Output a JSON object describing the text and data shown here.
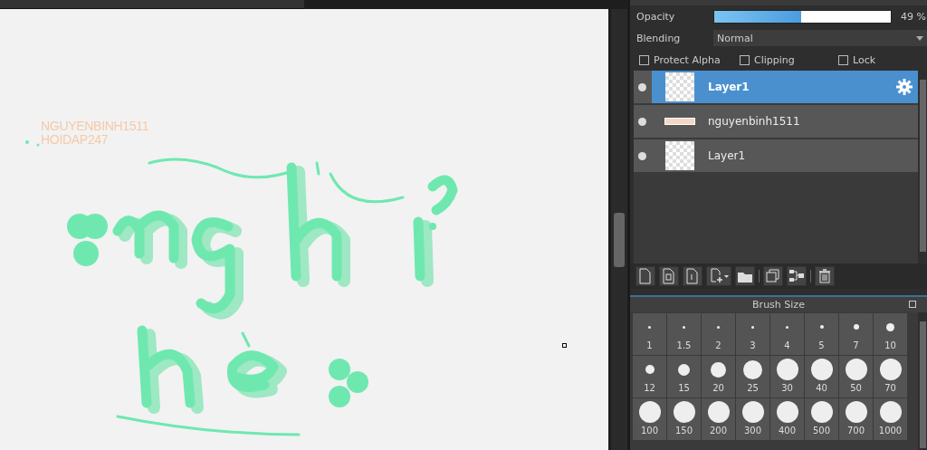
{
  "canvas": {
    "signature": [
      "NGUYENBINH1511",
      "HOIDAP247"
    ]
  },
  "layer_panel": {
    "opacity": {
      "label": "Opacity",
      "level": 0.49,
      "reading": "49 %"
    },
    "blending": {
      "label": "Blending",
      "value": "Normal"
    },
    "options": [
      {
        "label": "Protect Alpha",
        "checked": false
      },
      {
        "label": "Clipping",
        "checked": false
      },
      {
        "label": "Lock",
        "checked": false
      }
    ],
    "layers": [
      {
        "name": "Layer1",
        "selected": true,
        "kind": "blank"
      },
      {
        "name": "nguyenbinh1511",
        "selected": false,
        "kind": "strip"
      },
      {
        "name": "Layer1",
        "selected": false,
        "kind": "blank"
      }
    ]
  },
  "brush_size": {
    "title": "Brush Size",
    "sizes": [
      "1",
      "1.5",
      "2",
      "3",
      "4",
      "5",
      "7",
      "10",
      "12",
      "15",
      "20",
      "25",
      "30",
      "40",
      "50",
      "70",
      "100",
      "150",
      "200",
      "300",
      "400",
      "500",
      "700",
      "1000"
    ]
  }
}
